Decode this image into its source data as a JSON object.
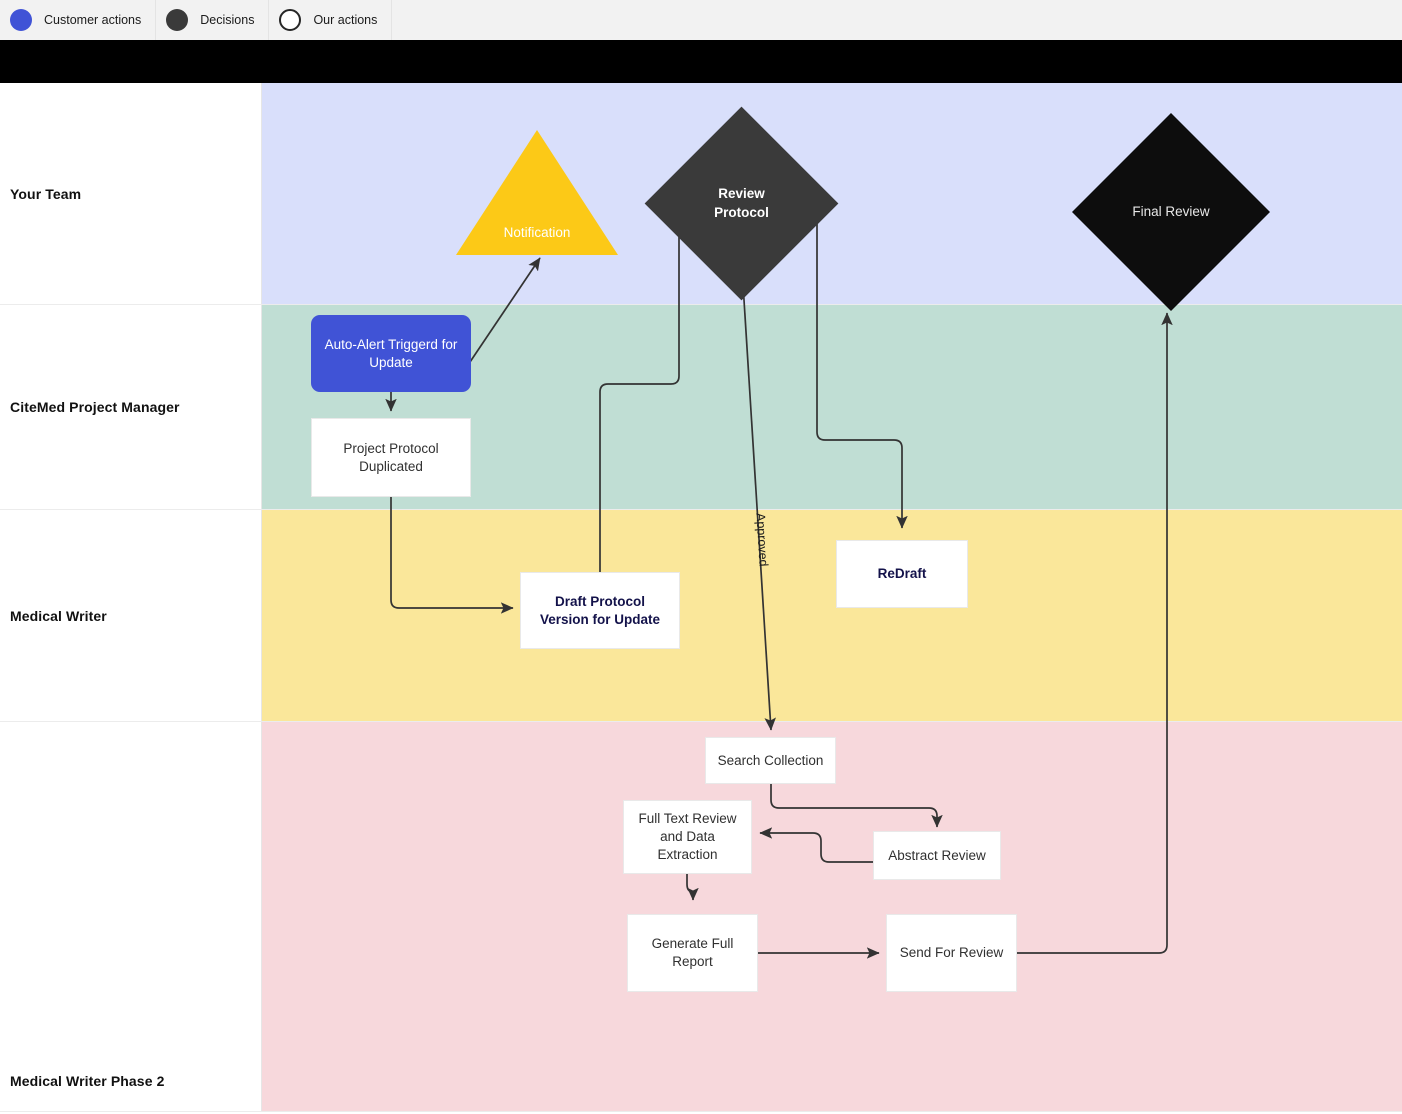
{
  "legend": {
    "items": [
      {
        "label": "Customer actions",
        "swatch": "filled-circle-blue",
        "color": "#4053d6"
      },
      {
        "label": "Decisions",
        "swatch": "filled-circle-dark",
        "color": "#3a3a3a"
      },
      {
        "label": "Our actions",
        "swatch": "outline-circle-white",
        "color": "#ffffff"
      }
    ]
  },
  "title_bar": {
    "color": "#000000",
    "label": ""
  },
  "lanes": [
    {
      "id": "your-team",
      "label": "Your Team",
      "color": "#d9dffb"
    },
    {
      "id": "citemed-project-manager",
      "label": "CiteMed Project Manager",
      "color": "#c0ded4"
    },
    {
      "id": "medical-writer",
      "label": "Medical Writer",
      "color": "#fae79a"
    },
    {
      "id": "medical-writer-phase-2",
      "label": "Medical Writer Phase 2",
      "color": "#f7d8dc"
    }
  ],
  "nodes": {
    "notification": {
      "label": "Notification",
      "shape": "triangle",
      "lane": "your-team",
      "fill": "#fcc917",
      "text_color": "#ffffff"
    },
    "review_protocol": {
      "label": "Review Protocol",
      "shape": "diamond",
      "lane": "your-team",
      "fill": "#3a3a3a",
      "text_color": "#ffffff"
    },
    "final_review": {
      "label": "Final Review",
      "shape": "diamond",
      "lane": "your-team",
      "fill": "#0d0d0d",
      "text_color": "#e8e8e8"
    },
    "auto_alert": {
      "label": "Auto-Alert Triggerd for Update",
      "shape": "rounded-rect",
      "lane": "citemed-project-manager",
      "fill": "#4053d6",
      "text_color": "#ffffff"
    },
    "project_protocol_duplicated": {
      "label": "Project Protocol Duplicated",
      "shape": "rect",
      "lane": "citemed-project-manager",
      "fill": "#ffffff",
      "text_color": "#303030"
    },
    "draft_protocol": {
      "label": "Draft Protocol Version for Update",
      "shape": "rect",
      "lane": "medical-writer",
      "fill": "#ffffff",
      "text_color": "#13124a",
      "bold": true
    },
    "redraft": {
      "label": "ReDraft",
      "shape": "rect",
      "lane": "medical-writer",
      "fill": "#ffffff",
      "text_color": "#13124a",
      "bold": true
    },
    "search_collection": {
      "label": "Search Collection",
      "shape": "rect",
      "lane": "medical-writer-phase-2",
      "fill": "#ffffff",
      "text_color": "#303030"
    },
    "full_text_review": {
      "label": "Full Text Review and Data Extraction",
      "shape": "rect",
      "lane": "medical-writer-phase-2",
      "fill": "#ffffff",
      "text_color": "#303030"
    },
    "abstract_review": {
      "label": "Abstract Review",
      "shape": "rect",
      "lane": "medical-writer-phase-2",
      "fill": "#ffffff",
      "text_color": "#303030"
    },
    "generate_full_report": {
      "label": "Generate Full Report",
      "shape": "rect",
      "lane": "medical-writer-phase-2",
      "fill": "#ffffff",
      "text_color": "#303030"
    },
    "send_for_review": {
      "label": "Send For Review",
      "shape": "rect",
      "lane": "medical-writer-phase-2",
      "fill": "#ffffff",
      "text_color": "#303030"
    }
  },
  "edges": [
    {
      "id": "auto-alert-to-notification",
      "from": "auto_alert",
      "to": "notification",
      "label": ""
    },
    {
      "id": "auto-alert-to-project-protocol",
      "from": "auto_alert",
      "to": "project_protocol_duplicated",
      "label": ""
    },
    {
      "id": "project-protocol-to-draft-protocol",
      "from": "project_protocol_duplicated",
      "to": "draft_protocol",
      "label": ""
    },
    {
      "id": "draft-protocol-to-review-protocol",
      "from": "draft_protocol",
      "to": "review_protocol",
      "label": ""
    },
    {
      "id": "review-protocol-to-redraft",
      "from": "review_protocol",
      "to": "redraft",
      "label": ""
    },
    {
      "id": "review-protocol-to-search-collection",
      "from": "review_protocol",
      "to": "search_collection",
      "label": "Approved"
    },
    {
      "id": "search-collection-to-abstract-review",
      "from": "search_collection",
      "to": "abstract_review",
      "label": ""
    },
    {
      "id": "abstract-review-to-full-text-review",
      "from": "abstract_review",
      "to": "full_text_review",
      "label": ""
    },
    {
      "id": "full-text-review-to-generate-full-report",
      "from": "full_text_review",
      "to": "generate_full_report",
      "label": ""
    },
    {
      "id": "generate-full-report-to-send-for-review",
      "from": "generate_full_report",
      "to": "send_for_review",
      "label": ""
    },
    {
      "id": "send-for-review-to-final-review",
      "from": "send_for_review",
      "to": "final_review",
      "label": ""
    }
  ]
}
